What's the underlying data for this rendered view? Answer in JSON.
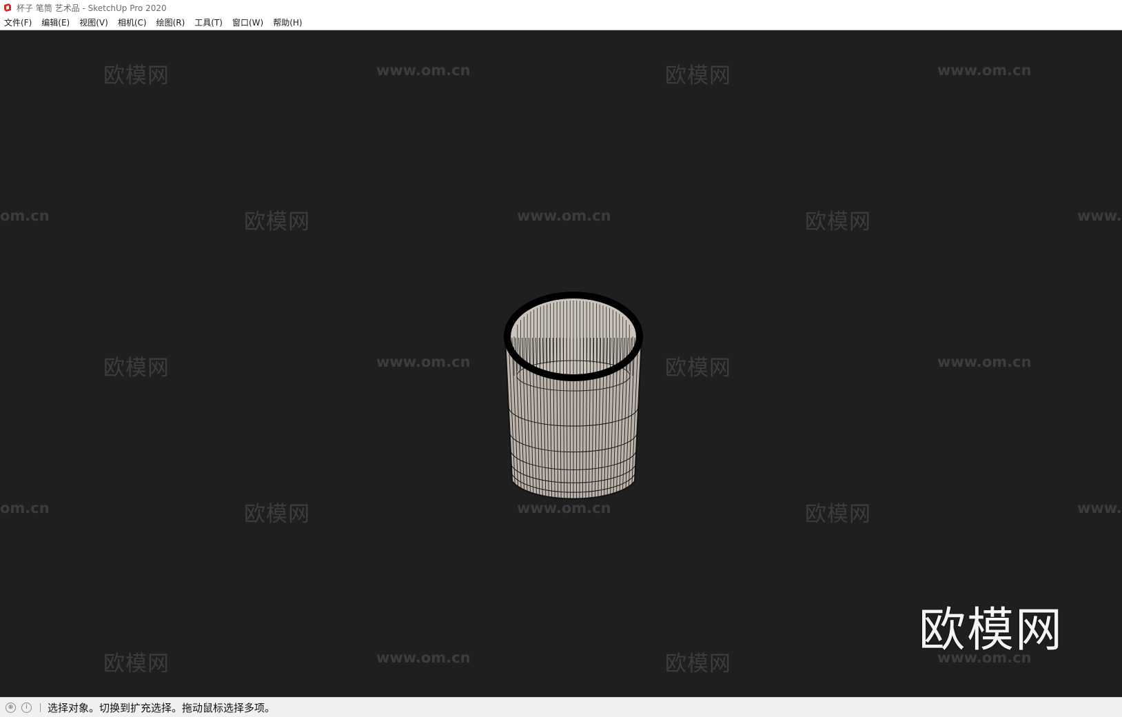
{
  "window": {
    "title": "杯子 笔筒 艺术品 - SketchUp Pro 2020",
    "app_icon": "sketchup-logo-icon"
  },
  "menu": {
    "items": [
      {
        "label": "文件(F)"
      },
      {
        "label": "编辑(E)"
      },
      {
        "label": "视图(V)"
      },
      {
        "label": "相机(C)"
      },
      {
        "label": "绘图(R)"
      },
      {
        "label": "工具(T)"
      },
      {
        "label": "窗口(W)"
      },
      {
        "label": "帮助(H)"
      }
    ]
  },
  "viewport": {
    "watermark_cn": "欧模网",
    "watermark_url": "www.om.cn",
    "watermark_url_left": "om.cn",
    "watermark_url_right": "www.",
    "logo_text": "欧模网"
  },
  "status": {
    "geo_icon": "geolocation-icon",
    "info_icon": "info-icon",
    "message": "选择对象。切换到扩充选择。拖动鼠标选择多项。"
  },
  "colors": {
    "viewport_bg": "#1f1f1f",
    "model_fill": "#bdb5ab",
    "model_edges": "#111111"
  }
}
